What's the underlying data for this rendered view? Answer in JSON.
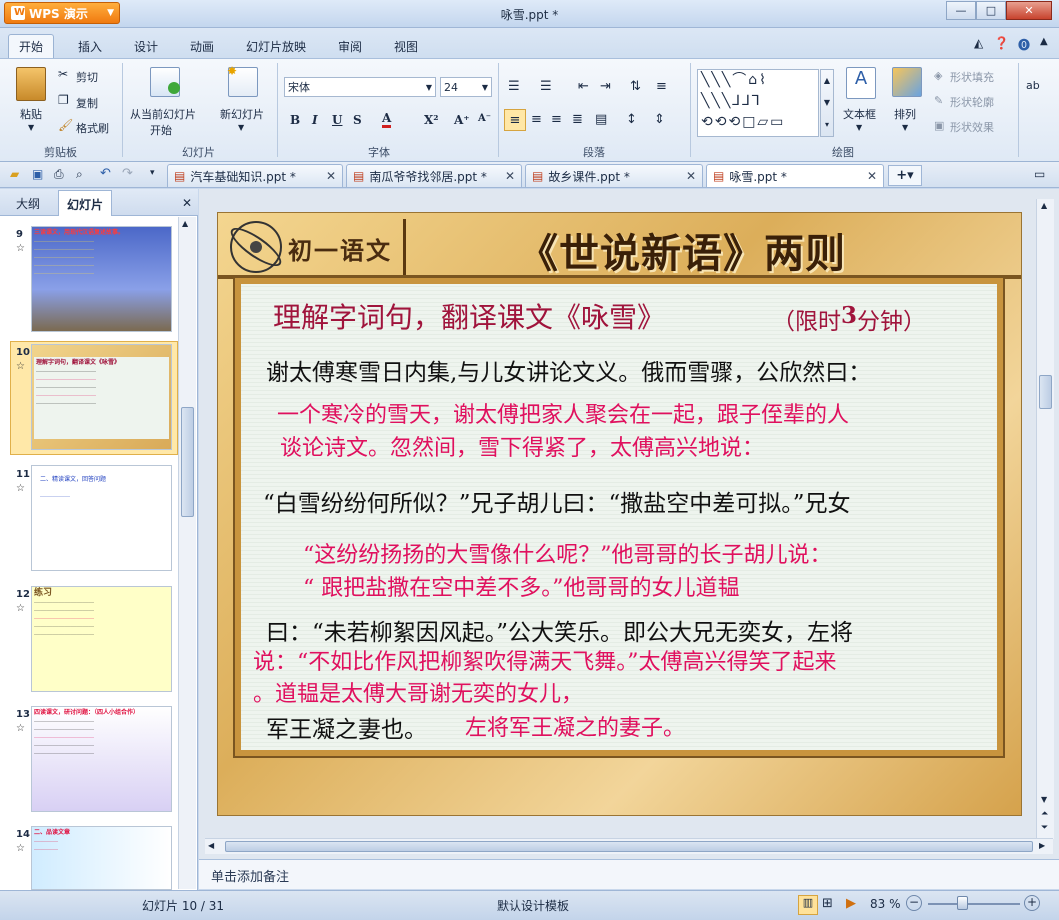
{
  "app": {
    "name": "WPS 演示",
    "doc_title": "咏雪.ppt *"
  },
  "menu_tabs": [
    "开始",
    "插入",
    "设计",
    "动画",
    "幻灯片放映",
    "审阅",
    "视图"
  ],
  "ribbon": {
    "paste": "粘贴",
    "cut": "剪切",
    "copy": "复制",
    "format_painter": "格式刷",
    "from_current_1": "从当前幻灯片",
    "from_current_2": "开始",
    "new_slide": "新幻灯片",
    "font_name": "宋体",
    "font_size": "24",
    "textbox": "文本框",
    "arrange": "排列",
    "shape_fill": "形状填充",
    "shape_outline": "形状轮廓",
    "shape_effect": "形状效果",
    "groups": {
      "clipboard": "剪贴板",
      "slides": "幻灯片",
      "font": "字体",
      "paragraph": "段落",
      "drawing": "绘图"
    }
  },
  "doc_tabs": [
    {
      "label": "汽车基础知识.ppt *"
    },
    {
      "label": "南瓜爷爷找邻居.ppt *"
    },
    {
      "label": "故乡课件.ppt *"
    },
    {
      "label": "咏雪.ppt *"
    }
  ],
  "left_panel": {
    "tabs": [
      "大纲",
      "幻灯片"
    ],
    "thumbs": [
      {
        "num": "9",
        "text": "三读课文，用现代汉语复述故事。"
      },
      {
        "num": "10",
        "text": "理解字词句，翻译课文《咏雪》"
      },
      {
        "num": "11",
        "text": "二、精读课文，回答问题"
      },
      {
        "num": "12",
        "text": "练习"
      },
      {
        "num": "13",
        "text": "四读课文，研讨问题：（四人小组合作）"
      },
      {
        "num": "14",
        "text": "二、品读文章"
      }
    ]
  },
  "slide": {
    "banner_left": "初一语文",
    "banner_right": "《世说新语》两则",
    "heading": "理解字词句，翻译课文《咏雪》",
    "heading_note_a": "（限时",
    "heading_note_num": "3",
    "heading_note_b": "分钟）",
    "line1": "谢太傅寒雪日内集,与儿女讲论文义。俄而雪骤，公欣然曰：",
    "trans1a": "一个寒冷的雪天，谢太傅把家人聚会在一起，跟子侄辈的人",
    "trans1b": "谈论诗文。忽然间，雪下得紧了，太傅高兴地说：",
    "line2": "“白雪纷纷何所似？”兄子胡儿曰：“撒盐空中差可拟。”兄女",
    "trans2a": "“这纷纷扬扬的大雪像什么呢？”他哥哥的长子胡儿说：",
    "trans2b": "“ 跟把盐撒在空中差不多。”他哥哥的女儿道韫",
    "line3": "曰：“未若柳絮因风起。”公大笑乐。即公大兄无奕女，左将",
    "trans3a": "说：“不如比作风把柳絮吹得满天飞舞。”太傅高兴得笑了起来",
    "trans3b": "。道韫是太傅大哥谢无奕的女儿，",
    "line4": "军王凝之妻也。",
    "trans4": "左将军王凝之的妻子。"
  },
  "notes_placeholder": "单击添加备注",
  "status": {
    "slide_info": "幻灯片 10 / 31",
    "template": "默认设计模板",
    "zoom": "83 %"
  }
}
